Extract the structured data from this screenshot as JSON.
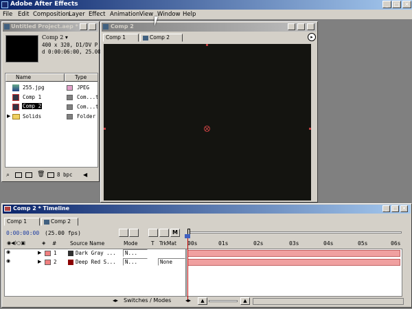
{
  "app": {
    "title": "Adobe After Effects",
    "window_buttons": [
      "_",
      "□",
      "✕"
    ]
  },
  "menu": [
    "File",
    "Edit",
    "Composition",
    "Layer",
    "Effect",
    "Animation",
    "View",
    "Window",
    "Help"
  ],
  "project": {
    "title": "Untitled Project.aep *",
    "selected_name": "Comp 2 ▾",
    "info_line1": "400 x 320, D1/DV P",
    "info_line2": "d 0:00:06:00, 25.00",
    "col_name": "Name",
    "col_type": "Type",
    "items": [
      {
        "name": "255.jpg",
        "type": "JPEG",
        "color": "#e0a0c8"
      },
      {
        "name": "Comp 1",
        "type": "Com...ti",
        "color": "#808080"
      },
      {
        "name": "Comp 2",
        "type": "Com...ti",
        "color": "#808080"
      },
      {
        "name": "Solids",
        "type": "Folder",
        "color": "#808080"
      }
    ],
    "bpc": "8 bpc"
  },
  "comp": {
    "title": "Comp 2",
    "tabs": [
      "Comp 1",
      "Comp 2"
    ],
    "background": "#141410"
  },
  "timeline": {
    "title": "Comp 2 * Timeline",
    "tabs": [
      "Comp 1",
      "Comp 2"
    ],
    "timecode": "0:00:00:00",
    "fps": "(25.00 fps)",
    "headers": {
      "num": "#",
      "source": "Source Name",
      "mode": "Mode",
      "t": "T",
      "trkmat": "TrkMat"
    },
    "ruler": [
      "00s",
      "01s",
      "02s",
      "03s",
      "04s",
      "05s",
      "06s"
    ],
    "layers": [
      {
        "num": "1",
        "name": "Dark Gray ...",
        "mode": "N...",
        "trkmat": "",
        "color": "#f08080",
        "swatch": "#303030"
      },
      {
        "num": "2",
        "name": "Deep Red S...",
        "mode": "N...",
        "trkmat": "None",
        "color": "#f08080",
        "swatch": "#8b0000"
      }
    ],
    "switches_label": "Switches / Modes"
  }
}
